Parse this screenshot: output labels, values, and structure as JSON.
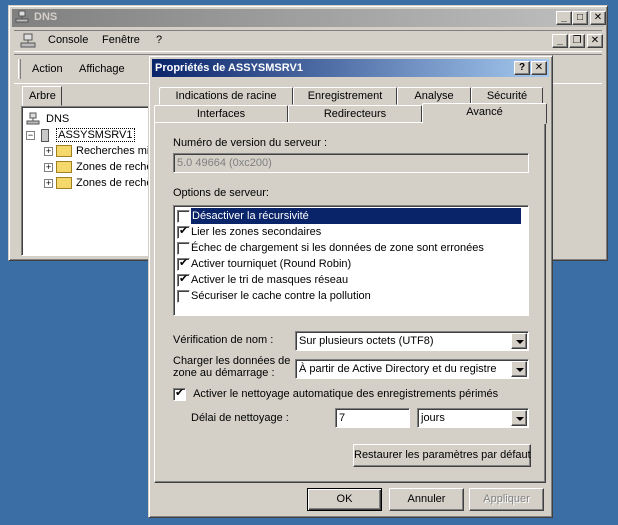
{
  "dns_window": {
    "title": "DNS",
    "menu": {
      "console": "Console",
      "window": "Fenêtre",
      "help": "?"
    },
    "toolbar": {
      "action": "Action",
      "view": "Affichage"
    },
    "tree_tab": "Arbre",
    "tree": {
      "root": "DNS",
      "server": "ASSYSMSRV1",
      "items": [
        "Recherches mise",
        "Zones de recher",
        "Zones de recher"
      ]
    }
  },
  "dialog": {
    "title": "Propriétés de ASSYSMSRV1",
    "help_btn": "?",
    "close_btn": "✕",
    "tabs_row1": [
      "Indications de racine",
      "Enregistrement",
      "Analyse",
      "Sécurité"
    ],
    "tabs_row2": [
      "Interfaces",
      "Redirecteurs",
      "Avancé"
    ],
    "version_label": "Numéro de version du serveur :",
    "version_value": "5.0 49664 (0xc200)",
    "options_label": "Options de serveur:",
    "options": [
      {
        "label": "Désactiver la récursivité",
        "checked": false,
        "selected": true
      },
      {
        "label": "Lier les zones secondaires",
        "checked": true,
        "selected": false
      },
      {
        "label": "Échec de chargement si les données de zone sont erronées",
        "checked": false,
        "selected": false
      },
      {
        "label": "Activer tourniquet (Round Robin)",
        "checked": true,
        "selected": false
      },
      {
        "label": "Activer le tri de masques réseau",
        "checked": true,
        "selected": false
      },
      {
        "label": "Sécuriser le cache contre la pollution",
        "checked": false,
        "selected": false
      }
    ],
    "name_check_label": "Vérification de nom :",
    "name_check_value": "Sur plusieurs octets (UTF8)",
    "load_label_line1": "Charger les données de",
    "load_label_line2": "zone au démarrage :",
    "load_value": "À partir de Active Directory et du registre",
    "scavenging_label": "Activer le nettoyage automatique des enregistrements périmés",
    "scavenging_checked": true,
    "interval_label": "Délai de nettoyage :",
    "interval_value": "7",
    "interval_unit": "jours",
    "reset_btn": "Restaurer les paramètres par défaut",
    "ok": "OK",
    "cancel": "Annuler",
    "apply": "Appliquer"
  }
}
